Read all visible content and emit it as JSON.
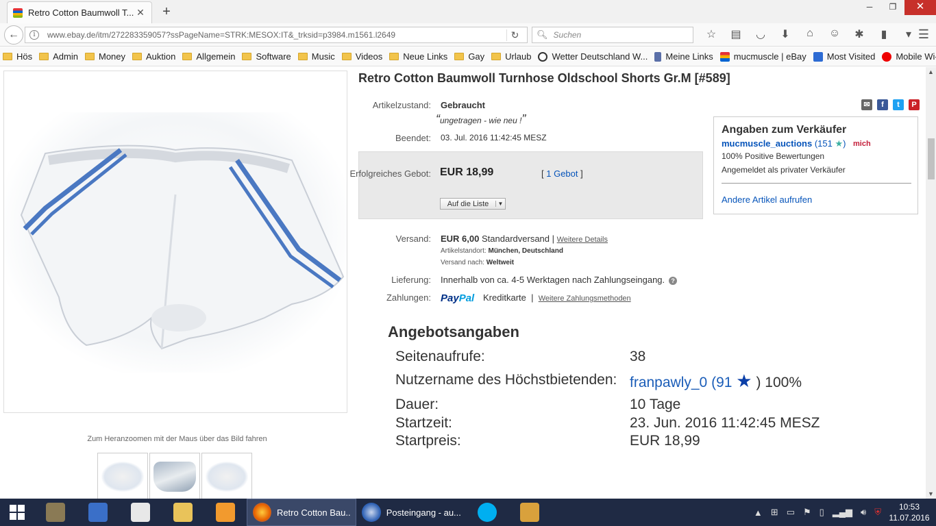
{
  "browser": {
    "tab_title": "Retro Cotton Baumwoll T...",
    "url": "www.ebay.de/itm/272283359057?ssPageName=STRK:MESOX:IT&_trksid=p3984.m1561.l2649",
    "search_placeholder": "Suchen",
    "bookmarks": [
      {
        "label": "Hös",
        "type": "folder"
      },
      {
        "label": "Admin",
        "type": "folder"
      },
      {
        "label": "Money",
        "type": "folder"
      },
      {
        "label": "Auktion",
        "type": "folder"
      },
      {
        "label": "Allgemein",
        "type": "folder"
      },
      {
        "label": "Software",
        "type": "folder"
      },
      {
        "label": "Music",
        "type": "folder"
      },
      {
        "label": "Videos",
        "type": "folder"
      },
      {
        "label": "Neue Links",
        "type": "folder"
      },
      {
        "label": "Gay",
        "type": "folder"
      },
      {
        "label": "Urlaub",
        "type": "folder"
      },
      {
        "label": "Wetter Deutschland W...",
        "type": "site"
      },
      {
        "label": "Meine Links",
        "type": "site"
      },
      {
        "label": "mucmuscle | eBay",
        "type": "site"
      },
      {
        "label": "Most Visited",
        "type": "site"
      },
      {
        "label": "Mobile Wi-Fi",
        "type": "site"
      }
    ]
  },
  "item": {
    "title": "Retro Cotton Baumwoll Turnhose Oldschool Shorts Gr.M [#589]",
    "zoom_hint": "Zum Heranzoomen mit der Maus über das Bild fahren",
    "condition_label": "Artikelzustand:",
    "condition_value": "Gebraucht",
    "condition_note": "ungetragen - wie neu !",
    "ended_label": "Beendet:",
    "ended_value": "03. Jul. 2016  11:42:45 MESZ",
    "bid_label": "Erfolgreiches Gebot:",
    "price": "EUR 18,99",
    "bids_open": "[",
    "bids_link": "1 Gebot",
    "bids_close": "]",
    "watch_button": "Auf die Liste",
    "shipping_label": "Versand:",
    "shipping_price": "EUR 6,00",
    "shipping_type": "Standardversand |",
    "shipping_more": "Weitere Details",
    "location_label": "Artikelstandort:",
    "location_value": "München, Deutschland",
    "ship_to_label": "Versand nach:",
    "ship_to_value": "Weltweit",
    "delivery_label": "Lieferung:",
    "delivery_value": "Innerhalb von ca. 4-5 Werktagen nach Zahlungseingang.",
    "payment_label": "Zahlungen:",
    "paypal_1": "Pay",
    "paypal_2": "Pal",
    "payment_card": "Kreditkarte",
    "payment_sep": "|",
    "payment_more": "Weitere Zahlungsmethoden"
  },
  "seller": {
    "heading": "Angaben zum Verkäufer",
    "name": "mucmuscle_auctions",
    "score": "(151",
    "score_close": ")",
    "me_badge": "mich",
    "positive": "100% Positive Bewertungen",
    "type": "Angemeldet als privater Verkäufer",
    "other_items": "Andere Artikel aufrufen"
  },
  "offer": {
    "heading": "Angebotsangaben",
    "views_label": "Seitenaufrufe:",
    "views_value": "38",
    "bidder_label": "Nutzername des Höchstbietenden:",
    "bidder_name": "franpawly_0",
    "bidder_score": "(91",
    "bidder_close": ")",
    "bidder_pct": "100%",
    "duration_label": "Dauer:",
    "duration_value": "10 Tage",
    "start_label": "Startzeit:",
    "start_value": "23. Jun. 2016 11:42:45 MESZ",
    "startprice_label": "Startpreis:",
    "startprice_value": "EUR 18,99"
  },
  "taskbar": {
    "firefox_window": "Retro Cotton Bau...",
    "mail_window": "Posteingang - au...",
    "time": "10:53",
    "date": "11.07.2016"
  },
  "colors": {
    "ebay_link": "#0654ba",
    "taskbar": "#1f2a44",
    "close_button": "#c7302a"
  }
}
